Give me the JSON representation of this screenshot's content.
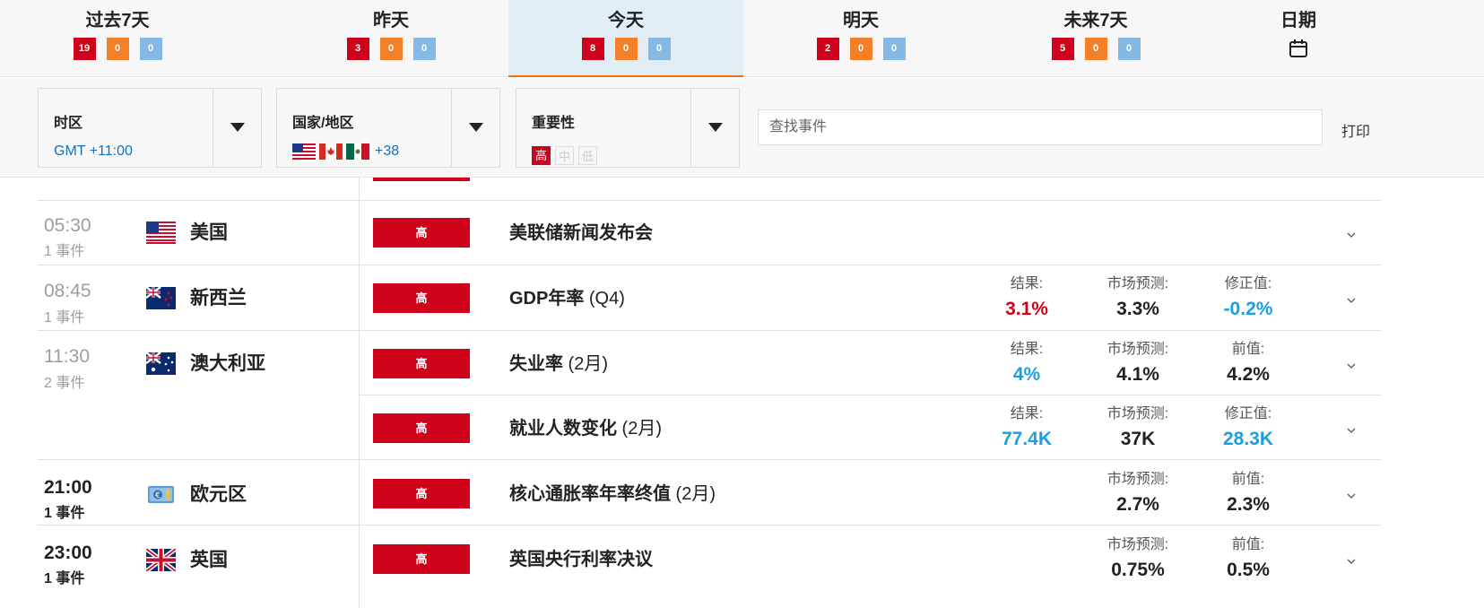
{
  "tabs": [
    {
      "label": "过去7天",
      "high": "19",
      "mid": "0",
      "low": "0"
    },
    {
      "label": "昨天",
      "high": "3",
      "mid": "0",
      "low": "0"
    },
    {
      "label": "今天",
      "high": "8",
      "mid": "0",
      "low": "0",
      "active": true
    },
    {
      "label": "明天",
      "high": "2",
      "mid": "0",
      "low": "0"
    },
    {
      "label": "未来7天",
      "high": "5",
      "mid": "0",
      "low": "0"
    },
    {
      "label": "日期",
      "icon": "calendar-icon"
    }
  ],
  "filters": {
    "timezone": {
      "title": "时区",
      "value": "GMT +11:00"
    },
    "country": {
      "title": "国家/地区",
      "flags": [
        "us-flag",
        "canada-flag",
        "mexico-flag"
      ],
      "more": "+38"
    },
    "importance": {
      "title": "重要性",
      "levels": [
        "高",
        "中",
        "低"
      ],
      "selected": "高"
    },
    "search_placeholder": "查找事件",
    "print_label": "打印"
  },
  "colors": {
    "high": "#d0021b",
    "mid": "#f5802a",
    "low": "#86b8e6",
    "link": "#1471b8",
    "accent": "#e8731f",
    "positive": "#1a9fe0"
  },
  "groups": [
    {
      "time": "05:30",
      "count": "1 事件",
      "country": "美国",
      "flag": "us-flag",
      "state": "past"
    },
    {
      "time": "08:45",
      "count": "1 事件",
      "country": "新西兰",
      "flag": "new-zealand-flag",
      "state": "past"
    },
    {
      "time": "11:30",
      "count": "2 事件",
      "country": "澳大利亚",
      "flag": "australia-flag",
      "state": "past"
    },
    {
      "time": "21:00",
      "count": "1 事件",
      "country": "欧元区",
      "flag": "euro-flag",
      "state": "future"
    },
    {
      "time": "23:00",
      "count": "1 事件",
      "country": "英国",
      "flag": "uk-flag",
      "state": "future"
    }
  ],
  "events": [
    {
      "importance": "高",
      "name": "美联储新闻发布会",
      "period": "",
      "stats": []
    },
    {
      "importance": "高",
      "name": "GDP年率",
      "period": " (Q4)",
      "stats": [
        {
          "label": "结果:",
          "value": "3.1%",
          "color": "red"
        },
        {
          "label": "市场预测:",
          "value": "3.3%",
          "color": "default"
        },
        {
          "label": "修正值:",
          "value": "-0.2%",
          "color": "blue"
        }
      ]
    },
    {
      "importance": "高",
      "name": "失业率",
      "period": " (2月)",
      "stats": [
        {
          "label": "结果:",
          "value": "4%",
          "color": "blue"
        },
        {
          "label": "市场预测:",
          "value": "4.1%",
          "color": "default"
        },
        {
          "label": "前值:",
          "value": "4.2%",
          "color": "default"
        }
      ]
    },
    {
      "importance": "高",
      "name": "就业人数变化",
      "period": " (2月)",
      "stats": [
        {
          "label": "结果:",
          "value": "77.4K",
          "color": "blue"
        },
        {
          "label": "市场预测:",
          "value": "37K",
          "color": "default"
        },
        {
          "label": "修正值:",
          "value": "28.3K",
          "color": "blue"
        }
      ]
    },
    {
      "importance": "高",
      "name": "核心通胀率年率终值",
      "period": " (2月)",
      "stats": [
        {
          "label": "市场预测:",
          "value": "2.7%",
          "color": "default"
        },
        {
          "label": "前值:",
          "value": "2.3%",
          "color": "default"
        }
      ]
    },
    {
      "importance": "高",
      "name": "英国央行利率决议",
      "period": "",
      "stats": [
        {
          "label": "市场预测:",
          "value": "0.75%",
          "color": "default"
        },
        {
          "label": "前值:",
          "value": "0.5%",
          "color": "default"
        }
      ]
    }
  ]
}
